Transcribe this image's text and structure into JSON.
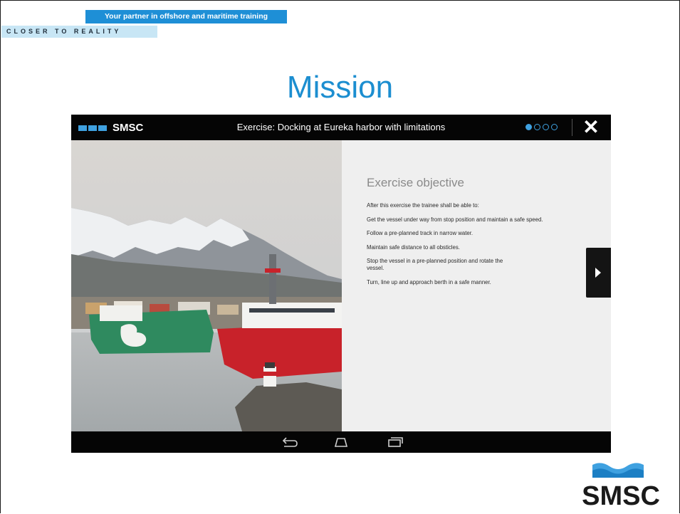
{
  "header": {
    "tagline": "Your partner in offshore and maritime training",
    "subtag": "CLOSER TO REALITY"
  },
  "slide": {
    "title": "Mission"
  },
  "app": {
    "brand": "SMSC",
    "exercise_title": "Exercise: Docking at Eureka harbor with limitations",
    "page_indicator": {
      "total": 4,
      "current": 1
    },
    "objective_heading": "Exercise objective",
    "objective_items": [
      "After this exercise the trainee shall be able to:",
      "Get the vessel under way from stop position and maintain a safe speed.",
      "Follow a pre-planned track in narrow water.",
      "Maintain safe distance to all obsticles.",
      "Stop the vessel in a pre-planned position and rotate the vessel.",
      "Turn, line up and approach berth in a safe manner."
    ],
    "nav_icons": [
      "back-icon",
      "home-icon",
      "recent-apps-icon"
    ]
  },
  "footer": {
    "brand": "SMSC"
  },
  "colors": {
    "accent": "#1c8ed0",
    "tagline_bg": "#1e8fd6",
    "subtag_bg": "#c8e6f5",
    "bar": "#050505"
  }
}
